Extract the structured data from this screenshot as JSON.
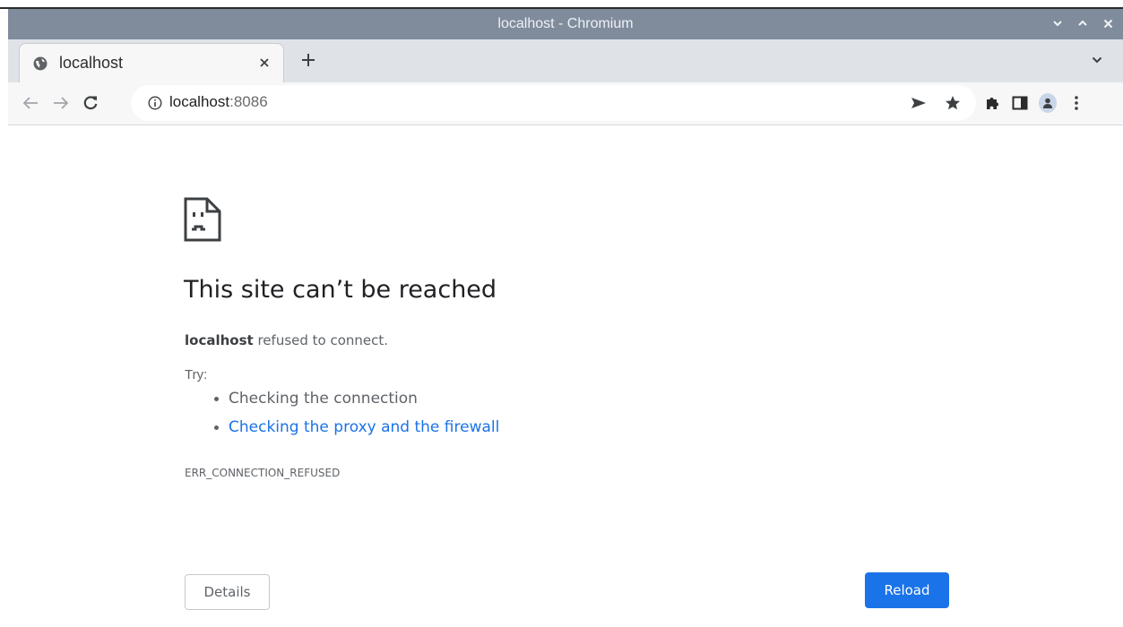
{
  "window": {
    "title": "localhost - Chromium",
    "controls": [
      "minimize-icon",
      "maximize-icon",
      "close-icon"
    ]
  },
  "tabs": [
    {
      "title": "localhost",
      "active": true,
      "favicon": "globe-icon"
    }
  ],
  "toolbar": {
    "url_host": "localhost",
    "url_port": ":8086"
  },
  "error_page": {
    "heading": "This site can’t be reached",
    "host": "localhost",
    "message": "refused to connect.",
    "try_label": "Try:",
    "suggestions": [
      {
        "text": "Checking the connection",
        "link": false
      },
      {
        "text": "Checking the proxy and the firewall",
        "link": true
      }
    ],
    "error_code": "ERR_CONNECTION_REFUSED",
    "details_button": "Details",
    "reload_button": "Reload"
  },
  "colors": {
    "titlebar": "#808c9c",
    "link": "#1a73e8",
    "primary_button": "#1a73e8",
    "body_text": "#5f6368"
  }
}
